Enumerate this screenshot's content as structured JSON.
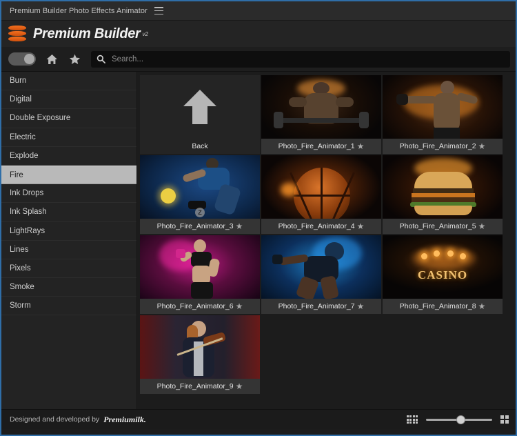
{
  "window": {
    "title": "Premium Builder Photo Effects Animator",
    "menu_icon": "hamburger-icon"
  },
  "brand": {
    "name": "Premium Builder",
    "version": "v2",
    "logo_icon": "layers-icon",
    "logo_color": "#ef6c1a"
  },
  "toolbar": {
    "toggle_state": "on",
    "home_icon": "home-icon",
    "favorites_icon": "star-icon",
    "search": {
      "icon": "search-icon",
      "value": "",
      "placeholder": "Search..."
    }
  },
  "sidebar": {
    "selected": "Fire",
    "items": [
      {
        "label": "Burn"
      },
      {
        "label": "Digital"
      },
      {
        "label": "Double Exposure"
      },
      {
        "label": "Electric"
      },
      {
        "label": "Explode"
      },
      {
        "label": "Fire"
      },
      {
        "label": "Ink Drops"
      },
      {
        "label": "Ink Splash"
      },
      {
        "label": "LightRays"
      },
      {
        "label": "Lines"
      },
      {
        "label": "Pixels"
      },
      {
        "label": "Smoke"
      },
      {
        "label": "Storm"
      }
    ]
  },
  "grid": {
    "back_tile": {
      "label": "Back",
      "icon": "arrow-up-icon"
    },
    "star_glyph": "★",
    "items": [
      {
        "label": "Photo_Fire_Animator_1",
        "scene": "sc1",
        "badge": ""
      },
      {
        "label": "Photo_Fire_Animator_2",
        "scene": "sc2",
        "badge": ""
      },
      {
        "label": "Photo_Fire_Animator_3",
        "scene": "sc3",
        "badge": "Z"
      },
      {
        "label": "Photo_Fire_Animator_4",
        "scene": "sc4",
        "badge": ""
      },
      {
        "label": "Photo_Fire_Animator_5",
        "scene": "sc5",
        "badge": ""
      },
      {
        "label": "Photo_Fire_Animator_6",
        "scene": "sc6",
        "badge": ""
      },
      {
        "label": "Photo_Fire_Animator_7",
        "scene": "sc7",
        "badge": ""
      },
      {
        "label": "Photo_Fire_Animator_8",
        "scene": "sc8",
        "badge": "",
        "overlay_text": "CASINO"
      },
      {
        "label": "Photo_Fire_Animator_9",
        "scene": "sc9",
        "badge": ""
      }
    ]
  },
  "footer": {
    "credit_text": "Designed and developed by",
    "credit_mark": "Premiumilk.",
    "small_grid_icon": "grid-small-icon",
    "large_grid_icon": "grid-large-icon",
    "zoom_slider_value": 46
  }
}
